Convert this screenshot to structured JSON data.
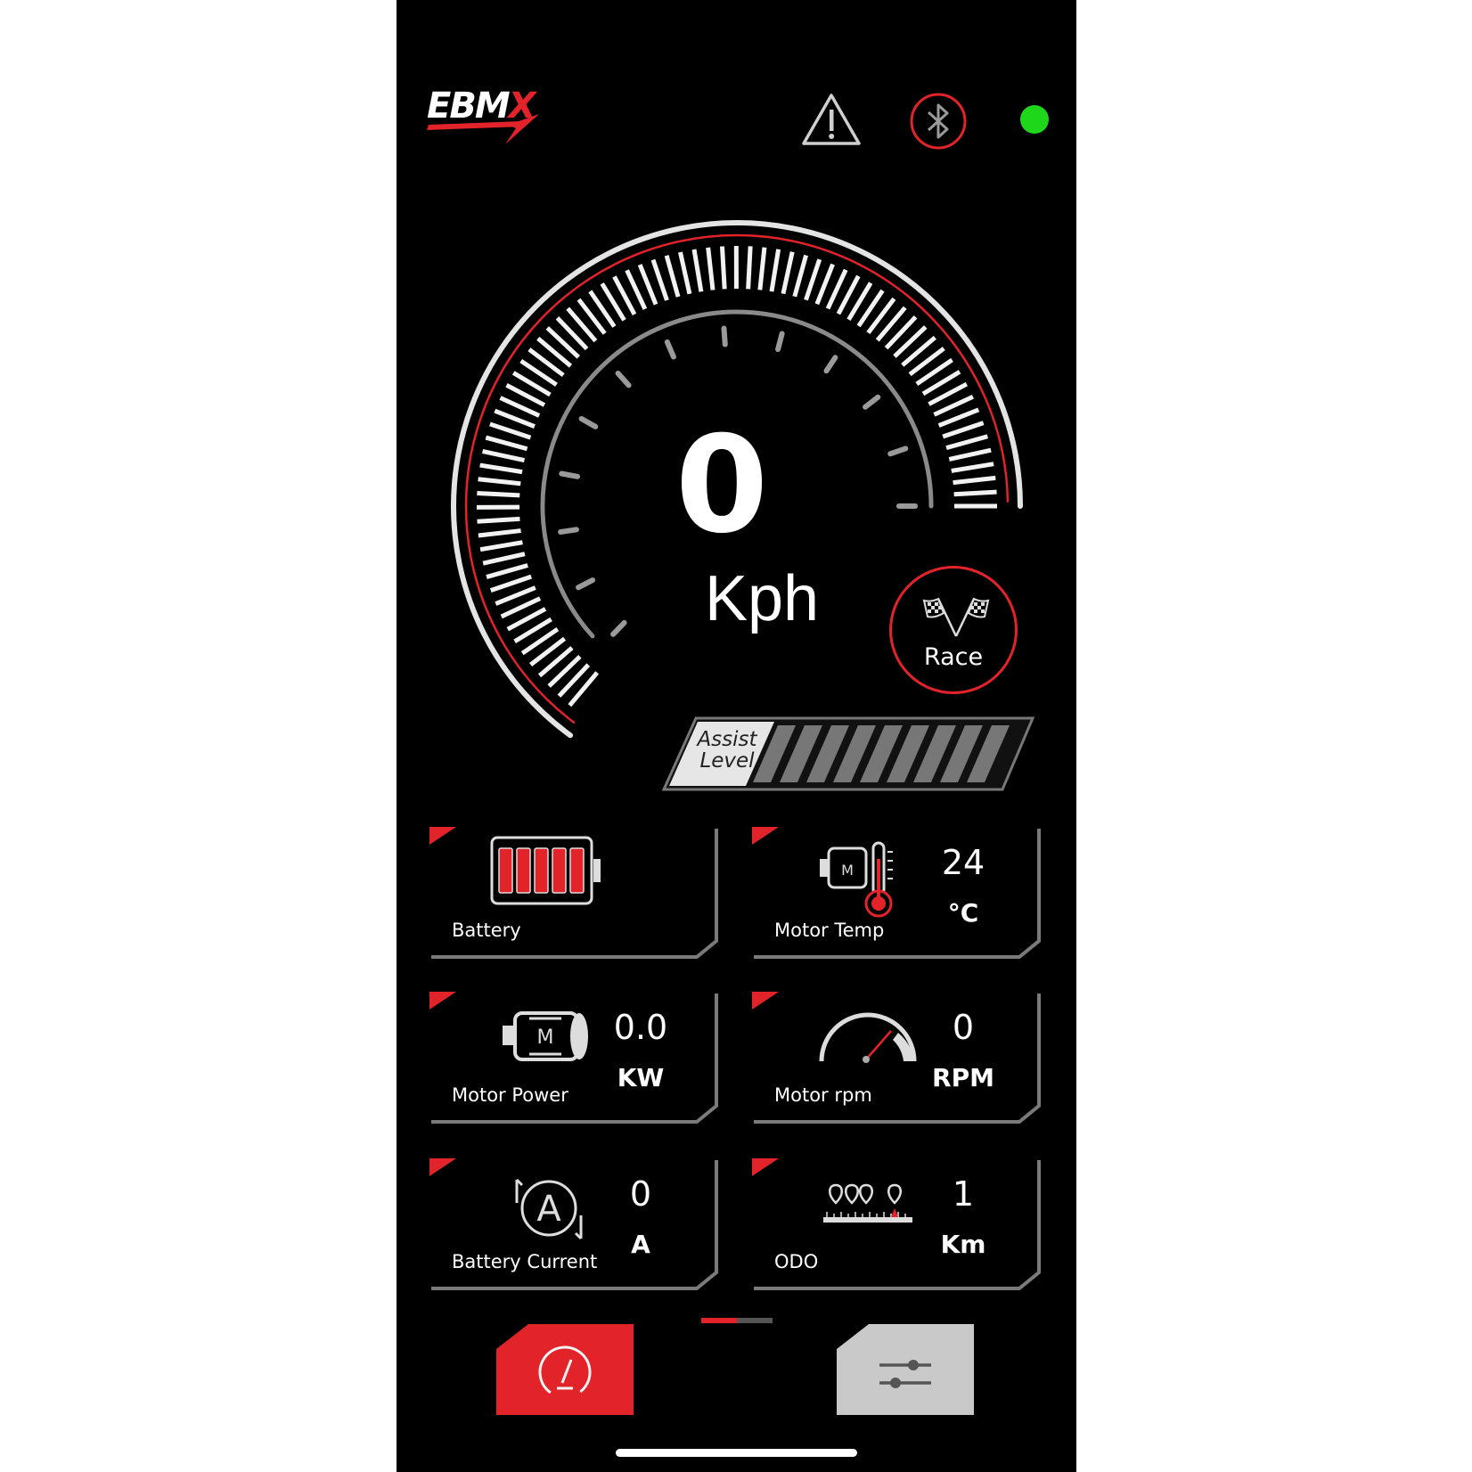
{
  "app": {
    "logo_text_main": "EBM",
    "logo_text_accent": "X"
  },
  "header": {
    "warning_icon": "warning-icon",
    "bluetooth_icon": "bluetooth-icon",
    "connection_status_color": "#1ed61a"
  },
  "speedometer": {
    "speed": "0",
    "unit": "Kph",
    "accent_color": "#e3232a"
  },
  "race_mode": {
    "label": "Race",
    "icon": "checkered-flags-icon"
  },
  "assist": {
    "label_line1": "Assist",
    "label_line2": "Level",
    "level": 0,
    "max_level": 9
  },
  "tiles": {
    "battery": {
      "label": "Battery",
      "level": 5,
      "max_level": 5
    },
    "motor_temp": {
      "label": "Motor Temp",
      "value": "24",
      "unit": "°C"
    },
    "motor_power": {
      "label": "Motor Power",
      "value": "0.0",
      "unit": "KW"
    },
    "motor_rpm": {
      "label": "Motor rpm",
      "value": "0",
      "unit": "RPM"
    },
    "battery_current": {
      "label": "Battery Current",
      "value": "0",
      "unit": "A"
    },
    "odo": {
      "label": "ODO",
      "value": "1",
      "unit": "Km"
    }
  },
  "nav": {
    "active_tab": "dashboard",
    "tabs": [
      "dashboard",
      "settings"
    ]
  }
}
